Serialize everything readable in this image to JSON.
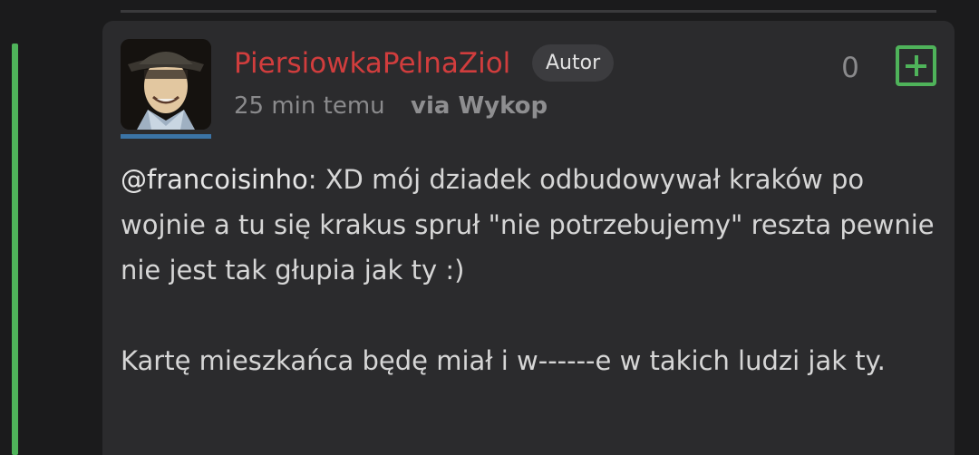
{
  "comment": {
    "username": "PiersiowkaPelnaZiol",
    "author_badge": "Autor",
    "time": "25 min temu",
    "source": "via Wykop",
    "votes": "0",
    "mention": "@francoisinho",
    "body_line1_rest": ": XD mój dziadek odbudowywał kraków po wojnie a tu się krakus spruł \"nie potrzebujemy\" reszta pewnie nie jest tak głupia jak ty :)",
    "body_paragraph2": "Kartę mieszkańca będę miał i w------e w takich ludzi jak ty."
  },
  "icons": {
    "plus": "plus-square-icon",
    "avatar": "user-avatar-image"
  },
  "colors": {
    "username": "#d13d3d",
    "accent_green": "#4fb35a",
    "avatar_bar": "#3b74a6",
    "card_background": "#2b2b2d",
    "page_background": "#1b1b1c"
  }
}
